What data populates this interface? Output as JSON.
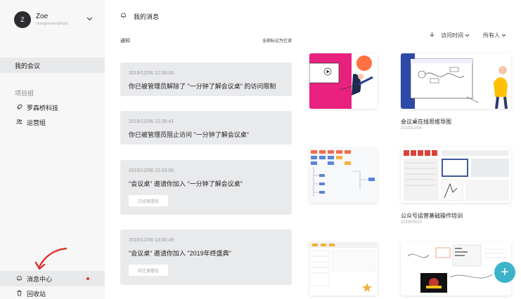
{
  "profile": {
    "avatar_letter": "Z",
    "name": "Zoe",
    "email": "zhangpanmin@huiyi..."
  },
  "sidebar": {
    "my_meetings": "我的会议",
    "project_group_label": "项目组",
    "groups": [
      {
        "label": "罗森桥科技",
        "icon": "rocket-icon"
      },
      {
        "label": "运营组",
        "icon": "people-icon"
      }
    ],
    "message_center": "消息中心",
    "recycle_bin": "回收站"
  },
  "header": {
    "title": "我的消息"
  },
  "notifications": {
    "section_label": "通知",
    "mark_all": "全部标记为已读",
    "items": [
      {
        "time": "2019/12/06 12:38:06",
        "text": "你已被管理员解除了 \"一分钟了解会议桌\" 的访问限制",
        "button": ""
      },
      {
        "time": "2019/12/06 12:36:41",
        "text": "你已被管理员阻止访问 \"一分钟了解会议桌\"",
        "button": ""
      },
      {
        "time": "2019/12/06 12:33:00",
        "text": "\"会议桌\" 邀请你加入 \"一分钟了解会议桌\"",
        "button": "已经掌握啦"
      },
      {
        "time": "2019/12/06 13:50:49",
        "text": "\"会议桌\" 邀请你加入 \"2019年终盛典\"",
        "button": "前往掌握啦"
      }
    ]
  },
  "controls": {
    "sort_label": "访问时间",
    "owner_label": "所有人"
  },
  "cards": [
    {
      "title": "",
      "date": ""
    },
    {
      "title": "会议桌在线思维导图",
      "date": "2019/12/06"
    },
    {
      "title": "",
      "date": ""
    },
    {
      "title": "公众号运营基础操作培训",
      "date": "2019/09/23"
    },
    {
      "title": "",
      "date": ""
    },
    {
      "title": "",
      "date": ""
    }
  ],
  "fab_label": "+",
  "colors": {
    "sidebar_bg": "#f7f7f8",
    "active_bg": "#e8e9eb",
    "notification_bg": "#e9eaec",
    "badge_red": "#d9333a",
    "fab": "#3bb3c9"
  }
}
